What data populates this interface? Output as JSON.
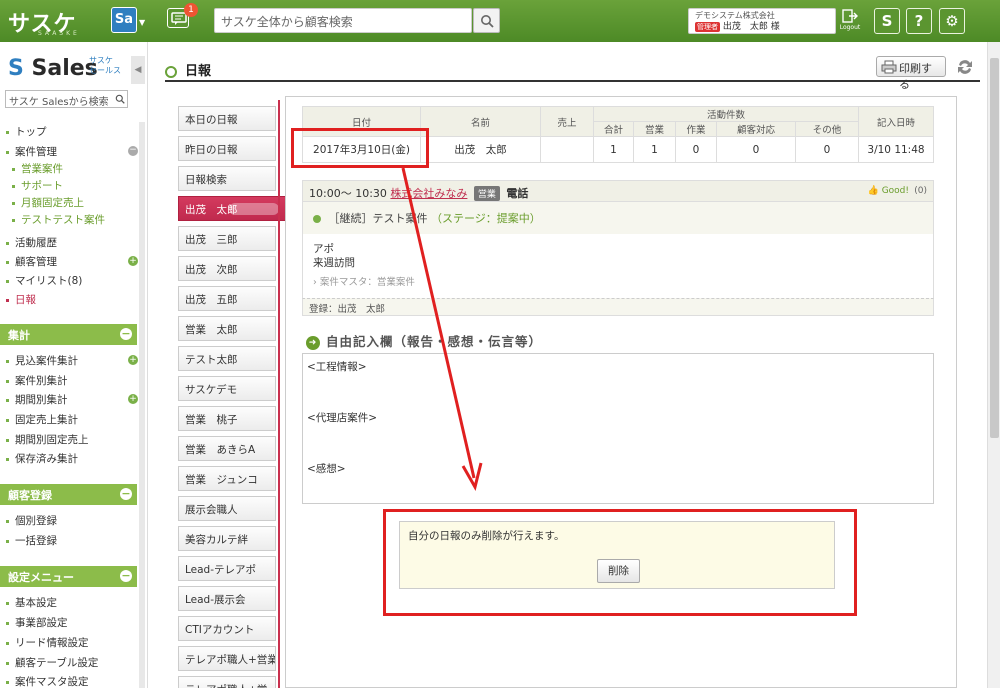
{
  "topbar": {
    "logo": "サスケ",
    "logo_sub": "SAASKE",
    "app_switch": "Sa",
    "notification_count": "1",
    "search_placeholder": "サスケ全体から顧客検索",
    "user": {
      "company": "デモシステム株式会社",
      "role": "管理者",
      "name": "出茂　太郎 様"
    },
    "logout_label": "Logout",
    "icons": [
      "sasuke-icon",
      "help-icon",
      "gear-icon"
    ]
  },
  "sidebar": {
    "logo": "Sales",
    "logo_sub_top": "サスケ",
    "logo_sub_bottom": "セールス",
    "search_placeholder": "サスケ Salesから検索",
    "menu": [
      {
        "label": "トップ"
      },
      {
        "label": "案件管理"
      },
      {
        "label": "営業案件",
        "sub": true
      },
      {
        "label": "サポート",
        "sub": true
      },
      {
        "label": "月額固定売上",
        "sub": true
      },
      {
        "label": "テストテスト案件",
        "sub": true
      },
      {
        "label": "活動履歴"
      },
      {
        "label": "顧客管理"
      },
      {
        "label": "マイリスト(8)"
      },
      {
        "label": "日報",
        "active": true
      }
    ],
    "section_aggregate": "集計",
    "aggregate_items": [
      "見込案件集計",
      "案件別集計",
      "期間別集計",
      "固定売上集計",
      "期間別固定売上",
      "保存済み集計"
    ],
    "section_customer": "顧客登録",
    "customer_items": [
      "個別登録",
      "一括登録"
    ],
    "section_settings": "設定メニュー",
    "settings_items": [
      "基本設定",
      "事業部設定",
      "リード情報設定",
      "顧客テーブル設定",
      "案件マスタ設定"
    ]
  },
  "page": {
    "title": "日報",
    "print_label": "印刷する"
  },
  "user_list": [
    "本日の日報",
    "昨日の日報",
    "日報検索",
    "出茂　太郎",
    "出茂　三郎",
    "出茂　次郎",
    "出茂　五郎",
    "営業　太郎",
    "テスト太郎",
    "サスケデモ",
    "営業　桃子",
    "営業　あきらA",
    "営業　ジュンコ",
    "展示会職人",
    "美容カルテ絆",
    "Lead-テレアポ",
    "Lead-展示会",
    "CTIアカウント",
    "テレアポ職人+営業",
    "テレアポ職人+営"
  ],
  "active_user_index": 3,
  "stats": {
    "headers": {
      "date": "日付",
      "name": "名前",
      "sales": "売上",
      "activity": "活動件数",
      "recorded": "記入日時"
    },
    "sub_headers": [
      "合計",
      "営業",
      "作業",
      "顧客対応",
      "その他"
    ],
    "row": {
      "date": "2017年3月10日(金)",
      "name": "出茂　太郎",
      "sales": "",
      "total": "1",
      "eigyo": "1",
      "sagyo": "0",
      "kokyaku": "0",
      "sonota": "0",
      "recorded": "3/10 11:48"
    }
  },
  "activity": {
    "time": "10:00〜 10:30",
    "company": "株式会社みなみ",
    "type_badge": "営業",
    "method": "電話",
    "good_label": "Good!",
    "good_count": "(0)",
    "case_label": "［継続］テスト案件",
    "stage": "（ステージ：提案中）",
    "body_line1": "アポ",
    "body_line2": "来週訪問",
    "master": "案件マスタ：営業案件",
    "registered": "登録：出茂　太郎"
  },
  "free_entry": {
    "title": "自由記入欄（報告・感想・伝言等）",
    "line1": "<工程情報>",
    "line2": "<代理店案件>",
    "line3": "<感想>"
  },
  "delete_box": {
    "message": "自分の日報のみ削除が行えます。",
    "button": "削除"
  },
  "colors": {
    "topbar": "#5b9530",
    "accent_green": "#7ab048",
    "active_red": "#c03050",
    "annotation": "#e02020"
  }
}
